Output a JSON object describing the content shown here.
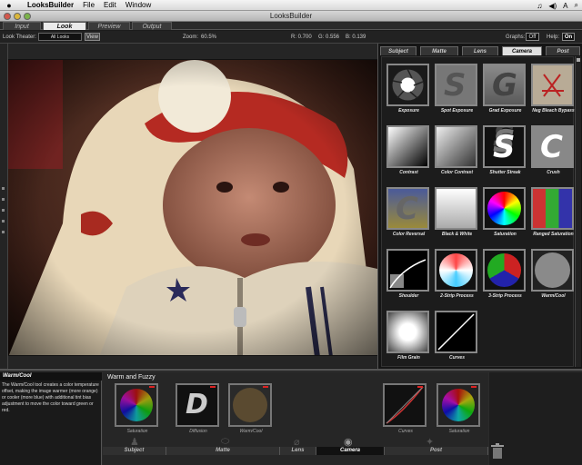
{
  "menubar": {
    "app_name": "LooksBuilder",
    "items": [
      "File",
      "Edit",
      "Window"
    ],
    "status_icons": [
      "♫",
      "◀)",
      "A",
      "⌕"
    ]
  },
  "window": {
    "title": "LooksBuilder"
  },
  "mode_tabs": [
    "Input",
    "Look",
    "Preview",
    "Output"
  ],
  "mode_tab_active": "Look",
  "toolbar": {
    "look_theater_label": "Look Theater:",
    "look_theater_value": "All Looks",
    "view_label": "View",
    "zoom_label": "Zoom:",
    "zoom_value": "60.5%",
    "r_label": "R: 0.700",
    "g_label": "G: 0.556",
    "b_label": "B: 0.139",
    "graphs_label": "Graphs:",
    "graphs_value": "Off",
    "help_label": "Help:",
    "help_value": "On"
  },
  "tool_tabs": [
    "Subject",
    "Matte",
    "Lens",
    "Camera",
    "Post"
  ],
  "tool_tab_active": "Camera",
  "tools": [
    {
      "label": "Exposure",
      "icon": "aperture-icon"
    },
    {
      "label": "Spot Exposure",
      "icon": "spot-exposure-icon"
    },
    {
      "label": "Grad Exposure",
      "icon": "grad-exposure-icon"
    },
    {
      "label": "Neg Bleach Bypass",
      "icon": "bleach-bypass-icon"
    },
    {
      "label": "Contrast",
      "icon": "contrast-icon"
    },
    {
      "label": "Color Contrast",
      "icon": "color-contrast-icon"
    },
    {
      "label": "Shutter Streak",
      "icon": "shutter-streak-icon"
    },
    {
      "label": "Crush",
      "icon": "crush-icon"
    },
    {
      "label": "Color Reversal",
      "icon": "color-reversal-icon"
    },
    {
      "label": "Black & White",
      "icon": "black-white-icon"
    },
    {
      "label": "Saturation",
      "icon": "color-wheel-icon"
    },
    {
      "label": "Ranged Saturation",
      "icon": "ranged-saturation-icon"
    },
    {
      "label": "Shoulder",
      "icon": "shoulder-curve-icon"
    },
    {
      "label": "2-Strip Process",
      "icon": "two-strip-icon"
    },
    {
      "label": "3-Strip Process",
      "icon": "three-strip-icon"
    },
    {
      "label": "Warm/Cool",
      "icon": "warm-cool-icon"
    },
    {
      "label": "Film Grain",
      "icon": "film-grain-icon"
    },
    {
      "label": "Curves",
      "icon": "curves-icon"
    }
  ],
  "description": {
    "title": "Warm/Cool",
    "text": "The Warm/Cool tool creates a color temperature offset, making the image warmer (more orange) or cooler (more blue) with additional tint bias adjustment to move the color toward green or red."
  },
  "stack": {
    "title": "Warm and Fuzzy",
    "items": [
      {
        "label": "Saturation",
        "icon": "color-wheel-icon"
      },
      {
        "label": "Diffusion",
        "icon": "diffusion-icon"
      },
      {
        "label": "Warm/Cool",
        "icon": "warm-cool-icon"
      },
      {
        "label": "Curves",
        "icon": "curves-icon"
      },
      {
        "label": "Saturation",
        "icon": "color-wheel-icon"
      }
    ],
    "categories": [
      "Subject",
      "Matte",
      "Lens",
      "Camera",
      "Post"
    ],
    "category_active": "Camera"
  },
  "colors": {
    "accent_red": "#dd2222",
    "panel_bg": "#151515"
  }
}
